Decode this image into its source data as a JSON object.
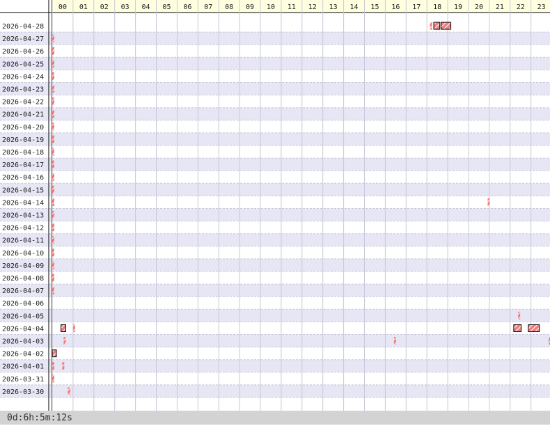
{
  "chart_data": {
    "type": "timeline",
    "hours": [
      "00",
      "01",
      "02",
      "03",
      "04",
      "05",
      "06",
      "07",
      "08",
      "09",
      "10",
      "11",
      "12",
      "13",
      "14",
      "15",
      "16",
      "17",
      "18",
      "19",
      "20",
      "21",
      "22",
      "23"
    ],
    "dates": [
      "2026-04-28",
      "2026-04-27",
      "2026-04-26",
      "2026-04-25",
      "2026-04-24",
      "2026-04-23",
      "2026-04-22",
      "2026-04-21",
      "2026-04-20",
      "2026-04-19",
      "2026-04-18",
      "2026-04-17",
      "2026-04-16",
      "2026-04-15",
      "2026-04-14",
      "2026-04-13",
      "2026-04-12",
      "2026-04-11",
      "2026-04-10",
      "2026-04-09",
      "2026-04-08",
      "2026-04-07",
      "2026-04-06",
      "2026-04-05",
      "2026-04-04",
      "2026-04-03",
      "2026-04-02",
      "2026-04-01",
      "2026-03-31",
      "2026-03-30"
    ],
    "events": [
      {
        "date": "2026-04-28",
        "start_hour": 18.15,
        "end_hour": 18.25
      },
      {
        "date": "2026-04-28",
        "start_hour": 18.33,
        "end_hour": 18.62
      },
      {
        "date": "2026-04-28",
        "start_hour": 18.68,
        "end_hour": 19.15
      },
      {
        "date": "2026-04-27",
        "start_hour": 0.0,
        "end_hour": 0.07
      },
      {
        "date": "2026-04-26",
        "start_hour": 0.0,
        "end_hour": 0.07
      },
      {
        "date": "2026-04-25",
        "start_hour": 0.0,
        "end_hour": 0.07
      },
      {
        "date": "2026-04-24",
        "start_hour": 0.0,
        "end_hour": 0.07
      },
      {
        "date": "2026-04-23",
        "start_hour": 0.0,
        "end_hour": 0.07
      },
      {
        "date": "2026-04-22",
        "start_hour": 0.0,
        "end_hour": 0.07
      },
      {
        "date": "2026-04-21",
        "start_hour": 0.0,
        "end_hour": 0.07
      },
      {
        "date": "2026-04-20",
        "start_hour": 0.0,
        "end_hour": 0.07
      },
      {
        "date": "2026-04-19",
        "start_hour": 0.0,
        "end_hour": 0.07
      },
      {
        "date": "2026-04-18",
        "start_hour": 0.0,
        "end_hour": 0.07
      },
      {
        "date": "2026-04-17",
        "start_hour": 0.0,
        "end_hour": 0.07
      },
      {
        "date": "2026-04-16",
        "start_hour": 0.0,
        "end_hour": 0.07
      },
      {
        "date": "2026-04-15",
        "start_hour": 0.0,
        "end_hour": 0.07
      },
      {
        "date": "2026-04-14",
        "start_hour": 0.0,
        "end_hour": 0.07
      },
      {
        "date": "2026-04-14",
        "start_hour": 20.92,
        "end_hour": 21.0
      },
      {
        "date": "2026-04-13",
        "start_hour": 0.0,
        "end_hour": 0.07
      },
      {
        "date": "2026-04-12",
        "start_hour": 0.0,
        "end_hour": 0.1
      },
      {
        "date": "2026-04-11",
        "start_hour": 0.0,
        "end_hour": 0.07
      },
      {
        "date": "2026-04-10",
        "start_hour": 0.0,
        "end_hour": 0.07
      },
      {
        "date": "2026-04-09",
        "start_hour": 0.0,
        "end_hour": 0.07
      },
      {
        "date": "2026-04-08",
        "start_hour": 0.0,
        "end_hour": 0.07
      },
      {
        "date": "2026-04-07",
        "start_hour": 0.0,
        "end_hour": 0.07
      },
      {
        "date": "2026-04-05",
        "start_hour": 22.38,
        "end_hour": 22.47
      },
      {
        "date": "2026-04-04",
        "start_hour": 0.42,
        "end_hour": 0.65
      },
      {
        "date": "2026-04-04",
        "start_hour": 1.0,
        "end_hour": 1.07
      },
      {
        "date": "2026-04-04",
        "start_hour": 22.17,
        "end_hour": 22.53
      },
      {
        "date": "2026-04-04",
        "start_hour": 22.87,
        "end_hour": 23.4
      },
      {
        "date": "2026-04-03",
        "start_hour": 0.55,
        "end_hour": 0.62
      },
      {
        "date": "2026-04-03",
        "start_hour": 16.42,
        "end_hour": 16.48
      },
      {
        "date": "2026-04-03",
        "start_hour": 23.85,
        "end_hour": 24.0
      },
      {
        "date": "2026-04-02",
        "start_hour": 0.0,
        "end_hour": 0.2
      },
      {
        "date": "2026-04-01",
        "start_hour": 0.0,
        "end_hour": 0.07
      },
      {
        "date": "2026-04-01",
        "start_hour": 0.48,
        "end_hour": 0.58
      },
      {
        "date": "2026-03-31",
        "start_hour": 0.0,
        "end_hour": 0.07
      },
      {
        "date": "2026-03-30",
        "start_hour": 0.75,
        "end_hour": 0.87
      }
    ],
    "colors": {
      "header_bg": "#ffffe0",
      "row_odd": "#e6e6f5",
      "row_even": "#ffffff",
      "grid": "#c8c8d8",
      "event_fill": "#f08080",
      "event_stripe": "#ffffff",
      "event_border": "#000000",
      "status_bg": "#d3d3d3"
    }
  },
  "status_bar": {
    "elapsed": "0d:6h:5m:12s"
  }
}
